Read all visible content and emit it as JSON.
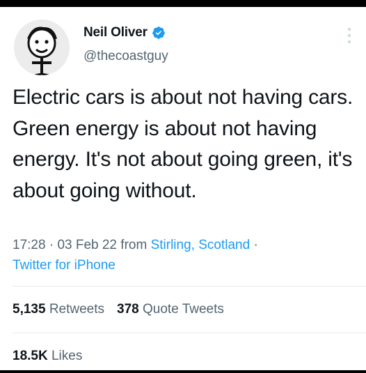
{
  "user": {
    "name": "Neil Oliver",
    "handle": "@thecoastguy",
    "avatar_icon": "sketch-face-avatar",
    "verified_icon": "verified-badge-icon",
    "verified_color": "#1d9bf0"
  },
  "tweet": {
    "text": "Electric cars is about not having cars. Green energy is about not having energy. It's not about going green, it's about going without.",
    "time": "17:28",
    "date": "03 Feb 22",
    "from_word": "from",
    "location": "Stirling, Scotland",
    "source": "Twitter for iPhone",
    "separator": "·"
  },
  "stats": {
    "retweets_count": "5,135",
    "retweets_label": "Retweets",
    "quotes_count": "378",
    "quotes_label": "Quote Tweets",
    "likes_count": "18.5K",
    "likes_label": "Likes"
  },
  "colors": {
    "accent": "#1d9bf0",
    "text": "#0f1419",
    "muted": "#536471"
  }
}
